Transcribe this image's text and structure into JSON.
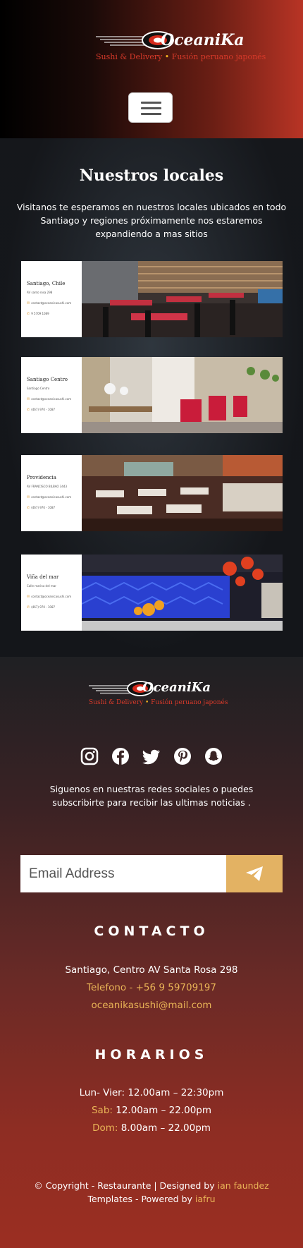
{
  "brand": {
    "name": "OceaniKa",
    "tagline_a": "Sushi & Delivery",
    "tagline_b": "Fusión peruano japonés"
  },
  "nav": {
    "menu_button": "menu"
  },
  "locales": {
    "title": "Nuestros locales",
    "description": "Visitanos te esperamos en nuestros locales ubicados en todo Santiago y regiones próximamente nos estaremos expandiendo a mas sitios",
    "cards": [
      {
        "name": "Santiago, Chile",
        "address": "AV santo rosa 298",
        "email": "contact@oceanicasushi.com",
        "phone": "9 5709 1089"
      },
      {
        "name": "Santiago Centro",
        "address": "Santiago Centro",
        "email": "contact@oceanicasushi.com",
        "phone": "(467) 970 - 1087"
      },
      {
        "name": "Providencia",
        "address": "AV FRANCISCO BILBAO 3443",
        "email": "contact@oceanicasushi.com",
        "phone": "(467) 970 - 1087"
      },
      {
        "name": "Viña del mar",
        "address": "Calle marina del mar",
        "email": "contact@oceanicasushi.com",
        "phone": "(467) 970 - 1087"
      }
    ]
  },
  "footer": {
    "follow_text": "Siguenos en nuestras redes sociales o puedes subscribirte para recibir las ultimas noticias .",
    "email_placeholder": "Email Address",
    "social": [
      "instagram-icon",
      "facebook-icon",
      "twitter-icon",
      "pinterest-icon",
      "snapchat-icon"
    ],
    "contacto": {
      "title": "CONTACTO",
      "address": "Santiago, Centro AV Santa Rosa 298",
      "phone": "Telefono - +56 9 59709197",
      "email": "oceanikasushi@mail.com"
    },
    "horarios": {
      "title": "HORARIOS",
      "weekday": "Lun- Vier: 12.00am – 22:30pm",
      "sab_label": "Sab:",
      "sab_hours": " 12.00am – 22.00pm",
      "dom_label": "Dom:",
      "dom_hours": " 8.00am – 22.00pm"
    },
    "copyright": {
      "prefix": "© Copyright - Restaurante | Designed by ",
      "designer": "ian faundez",
      "middle": " Templates - Powered by ",
      "powered": "iafru"
    }
  },
  "colors": {
    "accent_gold": "#e9b457",
    "brand_red": "#d93a2a",
    "send_button": "#e3b263"
  }
}
